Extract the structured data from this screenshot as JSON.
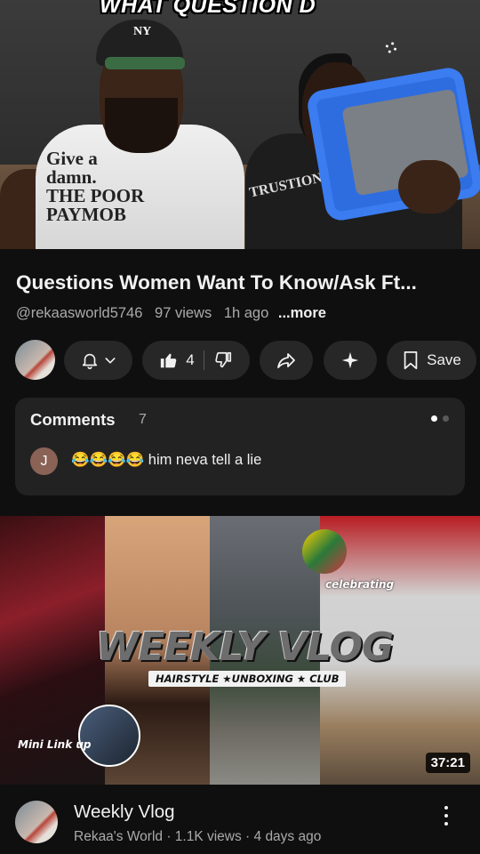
{
  "video": {
    "overlay_text": "WHAT QUESTION D",
    "shirt_text": "Give a\ndamn.\nTHE POOR\nPAYMOB",
    "shirt2_text": "TRUSTION",
    "title": "Questions Women Want To Know/Ask Ft...",
    "channel_handle": "@rekaasworld5746",
    "views": "97 views",
    "age": "1h ago",
    "more_label": "...more"
  },
  "actions": {
    "like_count": "4",
    "save_label": "Save"
  },
  "comments": {
    "title": "Comments",
    "count": "7",
    "first": {
      "avatar_letter": "J",
      "text": "😂😂😂😂 him neva tell a lie"
    }
  },
  "next_video": {
    "thumb_title": "WEEKLY VLOG",
    "thumb_subtitle": "HAIRSTYLE ★UNBOXING ★ CLUB",
    "sticker_link": "Mini Link up",
    "sticker_celebrating": "celebrating",
    "duration": "37:21",
    "title": "Weekly Vlog",
    "meta": "Rekaa's World · 1.1K views · 4 days ago"
  },
  "colors": {
    "background": "#0f0f0f",
    "pill": "#272727",
    "card": "#222222",
    "secondary_text": "#aaaaaa"
  },
  "icons": [
    "bell-icon",
    "chevron-down-icon",
    "thumbs-up-icon",
    "thumbs-down-icon",
    "share-icon",
    "sparkle-icon",
    "bookmark-icon",
    "more-vert-icon"
  ]
}
